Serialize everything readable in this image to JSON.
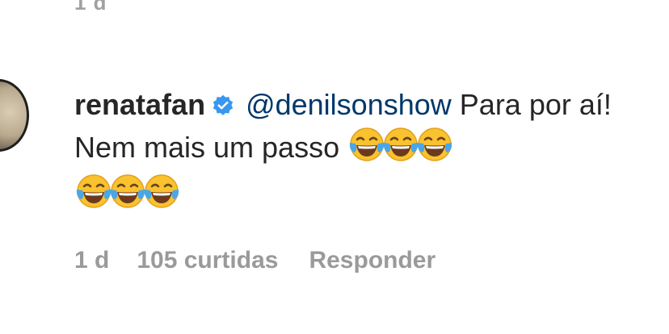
{
  "previous_comment": {
    "time": "1 d"
  },
  "comment": {
    "username": "renatafan",
    "verified": true,
    "mention": "@denilsonshow",
    "text": "Para por aí! Nem mais um passo",
    "emoji_name": "face-with-tears-of-joy-icon",
    "emoji_count_line1": 3,
    "emoji_count_line2": 3,
    "time": "1 d",
    "likes": "105 curtidas",
    "reply": "Responder"
  },
  "colors": {
    "text": "#262626",
    "mention": "#00376b",
    "meta": "#9a9a9a",
    "verified": "#3897f0"
  }
}
